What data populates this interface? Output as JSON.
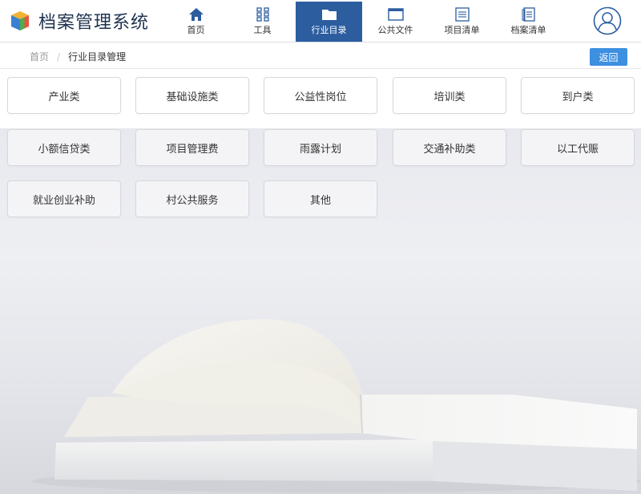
{
  "header": {
    "app_title": "档案管理系统",
    "nav": [
      {
        "label": "首页",
        "icon": "home-icon",
        "active": false
      },
      {
        "label": "工具",
        "icon": "grid-tools-icon",
        "active": false
      },
      {
        "label": "行业目录",
        "icon": "folder-icon",
        "active": true
      },
      {
        "label": "公共文件",
        "icon": "window-file-icon",
        "active": false
      },
      {
        "label": "项目清单",
        "icon": "list-frame-icon",
        "active": false
      },
      {
        "label": "档案清单",
        "icon": "document-list-icon",
        "active": false
      }
    ],
    "user_icon": "user-avatar-icon"
  },
  "breadcrumb": {
    "home": "首页",
    "current": "行业目录管理",
    "back_label": "返回"
  },
  "categories": [
    "产业类",
    "基础设施类",
    "公益性岗位",
    "培训类",
    "到户类",
    "小额信贷类",
    "项目管理费",
    "雨露计划",
    "交通补助类",
    "以工代赈",
    "就业创业补助",
    "村公共服务",
    "其他"
  ],
  "colors": {
    "nav_active": "#2b5d9f",
    "back_button": "#3d8fe0",
    "title_text": "#1f3350"
  }
}
